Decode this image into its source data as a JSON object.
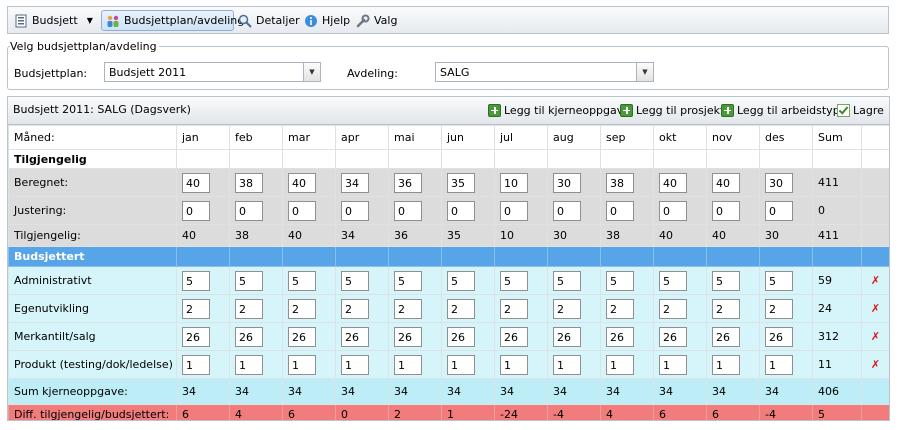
{
  "toolbar": {
    "budget_label": "Budsjett",
    "budgetplan_label": "Budsjettplan/avdeling",
    "details_label": "Detaljer",
    "help_label": "Hjelp",
    "settings_label": "Valg"
  },
  "selector": {
    "legend": "Velg budsjettplan/avdeling",
    "plan_label": "Budsjettplan:",
    "plan_value": "Budsjett 2011",
    "dept_label": "Avdeling:",
    "dept_value": "SALG"
  },
  "grid": {
    "title": "Budsjett 2011: SALG (Dagsverk)",
    "actions": {
      "add_core": "Legg til kjerneoppgave",
      "add_project": "Legg til prosjekt",
      "add_worktype": "Legg til arbeidstype",
      "save": "Lagre"
    },
    "month_header": "Måned:",
    "months": [
      "jan",
      "feb",
      "mar",
      "apr",
      "mai",
      "jun",
      "jul",
      "aug",
      "sep",
      "okt",
      "nov",
      "des"
    ],
    "sum_header": "Sum",
    "available_section": "Tilgjengelig",
    "calculated": {
      "label": "Beregnet:",
      "values": [
        "40",
        "38",
        "40",
        "34",
        "36",
        "35",
        "10",
        "30",
        "38",
        "40",
        "40",
        "30"
      ],
      "sum": "411"
    },
    "adjustment": {
      "label": "Justering:",
      "values": [
        "0",
        "0",
        "0",
        "0",
        "0",
        "0",
        "0",
        "0",
        "0",
        "0",
        "0",
        "0"
      ],
      "sum": "0"
    },
    "available_total": {
      "label": "Tilgjengelig:",
      "values": [
        "40",
        "38",
        "40",
        "34",
        "36",
        "35",
        "10",
        "30",
        "38",
        "40",
        "40",
        "30"
      ],
      "sum": "411"
    },
    "budgeted_section": "Budsjettert",
    "tasks": [
      {
        "name": "Administrativt",
        "values": [
          "5",
          "5",
          "5",
          "5",
          "5",
          "5",
          "5",
          "5",
          "5",
          "5",
          "5",
          "5"
        ],
        "sum": "59"
      },
      {
        "name": "Egenutvikling",
        "values": [
          "2",
          "2",
          "2",
          "2",
          "2",
          "2",
          "2",
          "2",
          "2",
          "2",
          "2",
          "2"
        ],
        "sum": "24"
      },
      {
        "name": "Merkantilt/salg",
        "values": [
          "26",
          "26",
          "26",
          "26",
          "26",
          "26",
          "26",
          "26",
          "26",
          "26",
          "26",
          "26"
        ],
        "sum": "312"
      },
      {
        "name": "Produkt (testing/dok/ledelse)",
        "values": [
          "1",
          "1",
          "1",
          "1",
          "1",
          "1",
          "1",
          "1",
          "1",
          "1",
          "1",
          "1"
        ],
        "sum": "11"
      }
    ],
    "sum_core": {
      "label": "Sum kjerneoppgave:",
      "values": [
        "34",
        "34",
        "34",
        "34",
        "34",
        "34",
        "34",
        "34",
        "34",
        "34",
        "34",
        "34"
      ],
      "sum": "406"
    },
    "diff": {
      "label": "Diff. tilgjengelig/budsjettert:",
      "values": [
        "6",
        "4",
        "6",
        "0",
        "2",
        "1",
        "-24",
        "-4",
        "4",
        "6",
        "6",
        "-4"
      ],
      "sum": "5"
    },
    "delete_icon": "red-x-icon"
  },
  "colors": {
    "budgeted_header": "#57a5e8",
    "task_row": "#d6f5fb",
    "sum_row": "#bdedf6",
    "diff_row": "#f27c7c",
    "gray_row": "#dcdcdc"
  }
}
